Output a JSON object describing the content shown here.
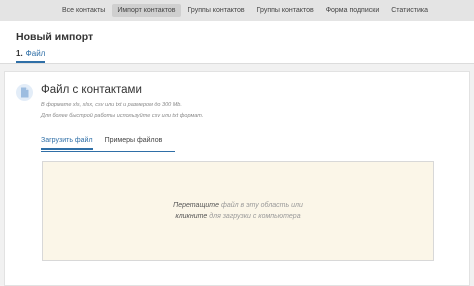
{
  "nav": {
    "items": [
      {
        "label": "Все контакты",
        "active": false
      },
      {
        "label": "Импорт контактов",
        "active": true
      },
      {
        "label": "Группы контактов",
        "active": false
      },
      {
        "label": "Группы контактов",
        "active": false
      },
      {
        "label": "Форма подписки",
        "active": false
      },
      {
        "label": "Статистика",
        "active": false
      }
    ]
  },
  "header": {
    "title": "Новый импорт",
    "step_number": "1.",
    "step_label": "Файл"
  },
  "card": {
    "icon": "file-icon",
    "title": "Файл с контактами",
    "hint_format": "В формате xls, xlsx, csv или txt и размером до 300 Mb.",
    "hint_speed": "Для более быстрой работы используйте csv или txt формат.",
    "tabs": [
      {
        "label": "Загрузить файл",
        "active": true
      },
      {
        "label": "Примеры файлов",
        "active": false
      }
    ],
    "dropzone": {
      "line1_em": "Перетащите",
      "line1_rest": " файл в эту область или",
      "line2_em": "кликните",
      "line2_rest": " для загрузки с компьютера"
    }
  },
  "colors": {
    "accent": "#2f6fa7",
    "dropzone_bg": "#fbf6e8",
    "nav_bg": "#e4e4e4"
  }
}
